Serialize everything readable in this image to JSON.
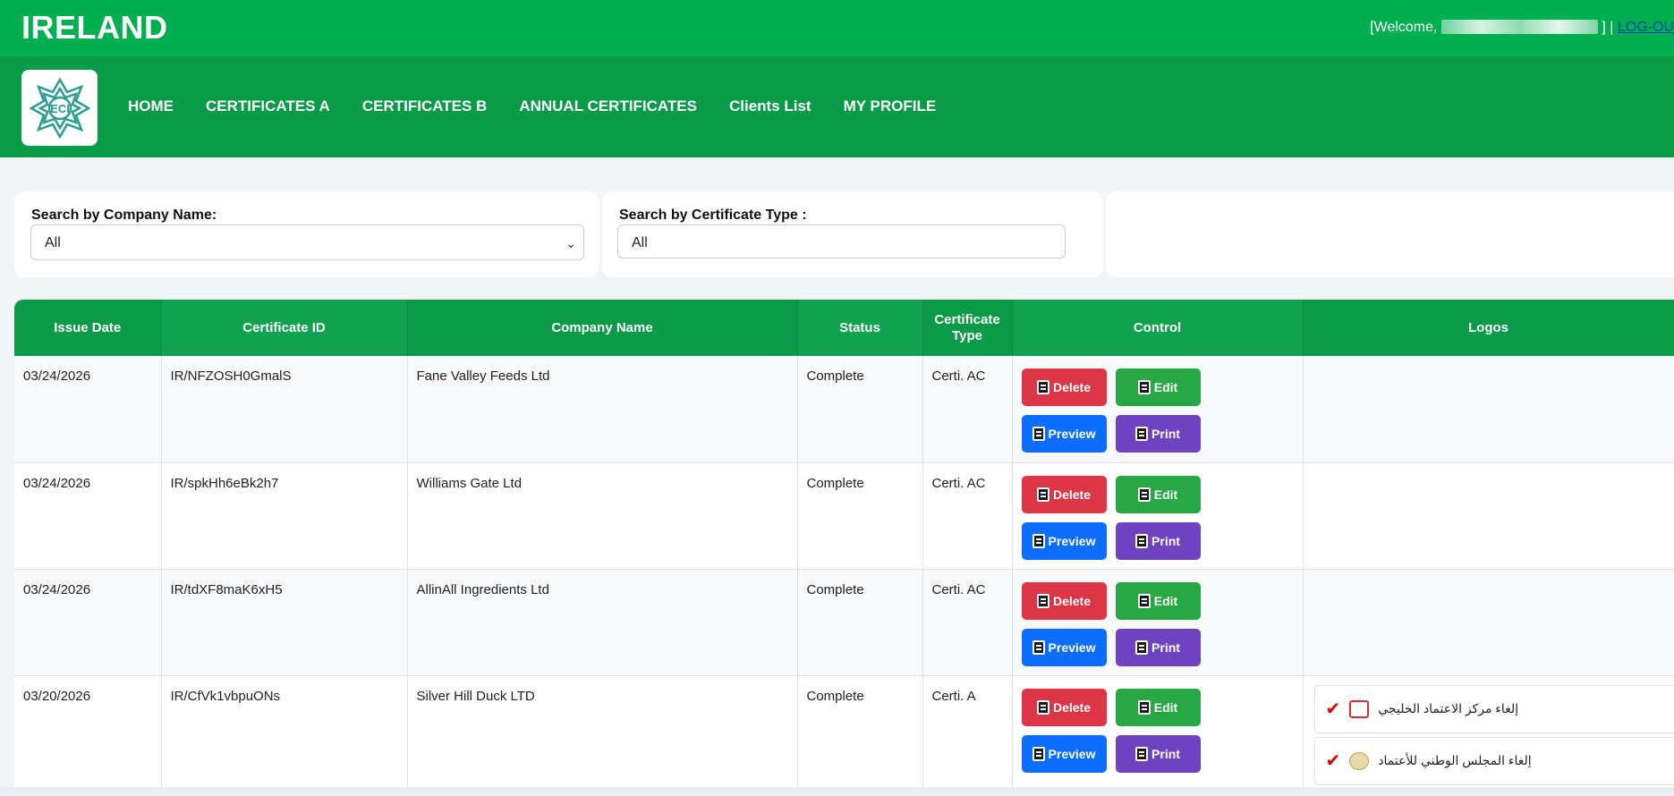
{
  "header": {
    "brand": "IRELAND",
    "welcome_prefix": "[Welcome,",
    "welcome_suffix": "] |",
    "logout": "LOG-OU"
  },
  "nav": {
    "items": [
      "HOME",
      "CERTIFICATES A",
      "CERTIFICATES B",
      "ANNUAL CERTIFICATES",
      "Clients List",
      "MY PROFILE"
    ]
  },
  "filters": {
    "company_label": "Search by Company Name:",
    "company_value": "All",
    "cert_type_label": "Search by Certificate Type :",
    "cert_type_value": "All"
  },
  "table": {
    "headers": [
      "Issue Date",
      "Certificate ID",
      "Company Name",
      "Status",
      "Certificate Type",
      "Control",
      "Logos"
    ],
    "rows": [
      {
        "date": "03/24/2026",
        "id": "IR/NFZOSH0GmalS",
        "company": "Fane Valley Feeds Ltd",
        "status": "Complete",
        "type": "Certi. AC"
      },
      {
        "date": "03/24/2026",
        "id": "IR/spkHh6eBk2h7",
        "company": "Williams Gate Ltd",
        "status": "Complete",
        "type": "Certi. AC"
      },
      {
        "date": "03/24/2026",
        "id": "IR/tdXF8maK6xH5",
        "company": "AllinAll Ingredients Ltd",
        "status": "Complete",
        "type": "Certi. AC"
      },
      {
        "date": "03/20/2026",
        "id": "IR/CfVk1vbpuONs",
        "company": "Silver Hill Duck LTD",
        "status": "Complete",
        "type": "Certi. A"
      }
    ],
    "buttons": {
      "delete": "Delete",
      "edit": "Edit",
      "preview": "Preview",
      "print": "Print"
    },
    "logo_lines": [
      "إلغاء مركز الاعتماد الخليجي",
      "إلغاء المجلس الوطني للأعتماد"
    ]
  },
  "colors": {
    "topbar": "#00b050",
    "navbar": "#0a9b48",
    "delete": "#dc3545",
    "edit": "#28a745",
    "preview": "#0d6efd",
    "print": "#6f42c1"
  }
}
